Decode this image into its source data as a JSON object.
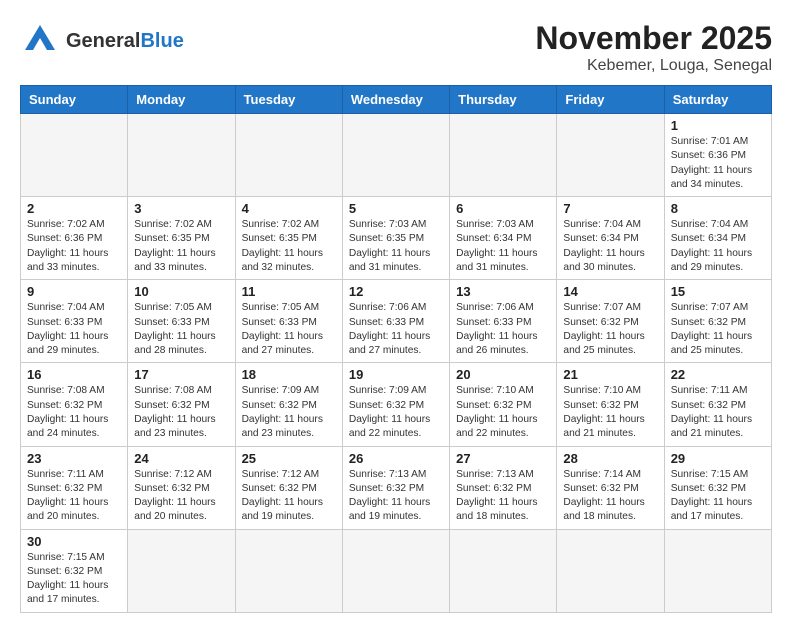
{
  "header": {
    "logo_general": "General",
    "logo_blue": "Blue",
    "title": "November 2025",
    "subtitle": "Kebemer, Louga, Senegal"
  },
  "weekdays": [
    "Sunday",
    "Monday",
    "Tuesday",
    "Wednesday",
    "Thursday",
    "Friday",
    "Saturday"
  ],
  "weeks": [
    [
      {
        "day": "",
        "info": ""
      },
      {
        "day": "",
        "info": ""
      },
      {
        "day": "",
        "info": ""
      },
      {
        "day": "",
        "info": ""
      },
      {
        "day": "",
        "info": ""
      },
      {
        "day": "",
        "info": ""
      },
      {
        "day": "1",
        "info": "Sunrise: 7:01 AM\nSunset: 6:36 PM\nDaylight: 11 hours\nand 34 minutes."
      }
    ],
    [
      {
        "day": "2",
        "info": "Sunrise: 7:02 AM\nSunset: 6:36 PM\nDaylight: 11 hours\nand 33 minutes."
      },
      {
        "day": "3",
        "info": "Sunrise: 7:02 AM\nSunset: 6:35 PM\nDaylight: 11 hours\nand 33 minutes."
      },
      {
        "day": "4",
        "info": "Sunrise: 7:02 AM\nSunset: 6:35 PM\nDaylight: 11 hours\nand 32 minutes."
      },
      {
        "day": "5",
        "info": "Sunrise: 7:03 AM\nSunset: 6:35 PM\nDaylight: 11 hours\nand 31 minutes."
      },
      {
        "day": "6",
        "info": "Sunrise: 7:03 AM\nSunset: 6:34 PM\nDaylight: 11 hours\nand 31 minutes."
      },
      {
        "day": "7",
        "info": "Sunrise: 7:04 AM\nSunset: 6:34 PM\nDaylight: 11 hours\nand 30 minutes."
      },
      {
        "day": "8",
        "info": "Sunrise: 7:04 AM\nSunset: 6:34 PM\nDaylight: 11 hours\nand 29 minutes."
      }
    ],
    [
      {
        "day": "9",
        "info": "Sunrise: 7:04 AM\nSunset: 6:33 PM\nDaylight: 11 hours\nand 29 minutes."
      },
      {
        "day": "10",
        "info": "Sunrise: 7:05 AM\nSunset: 6:33 PM\nDaylight: 11 hours\nand 28 minutes."
      },
      {
        "day": "11",
        "info": "Sunrise: 7:05 AM\nSunset: 6:33 PM\nDaylight: 11 hours\nand 27 minutes."
      },
      {
        "day": "12",
        "info": "Sunrise: 7:06 AM\nSunset: 6:33 PM\nDaylight: 11 hours\nand 27 minutes."
      },
      {
        "day": "13",
        "info": "Sunrise: 7:06 AM\nSunset: 6:33 PM\nDaylight: 11 hours\nand 26 minutes."
      },
      {
        "day": "14",
        "info": "Sunrise: 7:07 AM\nSunset: 6:32 PM\nDaylight: 11 hours\nand 25 minutes."
      },
      {
        "day": "15",
        "info": "Sunrise: 7:07 AM\nSunset: 6:32 PM\nDaylight: 11 hours\nand 25 minutes."
      }
    ],
    [
      {
        "day": "16",
        "info": "Sunrise: 7:08 AM\nSunset: 6:32 PM\nDaylight: 11 hours\nand 24 minutes."
      },
      {
        "day": "17",
        "info": "Sunrise: 7:08 AM\nSunset: 6:32 PM\nDaylight: 11 hours\nand 23 minutes."
      },
      {
        "day": "18",
        "info": "Sunrise: 7:09 AM\nSunset: 6:32 PM\nDaylight: 11 hours\nand 23 minutes."
      },
      {
        "day": "19",
        "info": "Sunrise: 7:09 AM\nSunset: 6:32 PM\nDaylight: 11 hours\nand 22 minutes."
      },
      {
        "day": "20",
        "info": "Sunrise: 7:10 AM\nSunset: 6:32 PM\nDaylight: 11 hours\nand 22 minutes."
      },
      {
        "day": "21",
        "info": "Sunrise: 7:10 AM\nSunset: 6:32 PM\nDaylight: 11 hours\nand 21 minutes."
      },
      {
        "day": "22",
        "info": "Sunrise: 7:11 AM\nSunset: 6:32 PM\nDaylight: 11 hours\nand 21 minutes."
      }
    ],
    [
      {
        "day": "23",
        "info": "Sunrise: 7:11 AM\nSunset: 6:32 PM\nDaylight: 11 hours\nand 20 minutes."
      },
      {
        "day": "24",
        "info": "Sunrise: 7:12 AM\nSunset: 6:32 PM\nDaylight: 11 hours\nand 20 minutes."
      },
      {
        "day": "25",
        "info": "Sunrise: 7:12 AM\nSunset: 6:32 PM\nDaylight: 11 hours\nand 19 minutes."
      },
      {
        "day": "26",
        "info": "Sunrise: 7:13 AM\nSunset: 6:32 PM\nDaylight: 11 hours\nand 19 minutes."
      },
      {
        "day": "27",
        "info": "Sunrise: 7:13 AM\nSunset: 6:32 PM\nDaylight: 11 hours\nand 18 minutes."
      },
      {
        "day": "28",
        "info": "Sunrise: 7:14 AM\nSunset: 6:32 PM\nDaylight: 11 hours\nand 18 minutes."
      },
      {
        "day": "29",
        "info": "Sunrise: 7:15 AM\nSunset: 6:32 PM\nDaylight: 11 hours\nand 17 minutes."
      }
    ],
    [
      {
        "day": "30",
        "info": "Sunrise: 7:15 AM\nSunset: 6:32 PM\nDaylight: 11 hours\nand 17 minutes."
      },
      {
        "day": "",
        "info": ""
      },
      {
        "day": "",
        "info": ""
      },
      {
        "day": "",
        "info": ""
      },
      {
        "day": "",
        "info": ""
      },
      {
        "day": "",
        "info": ""
      },
      {
        "day": "",
        "info": ""
      }
    ]
  ]
}
